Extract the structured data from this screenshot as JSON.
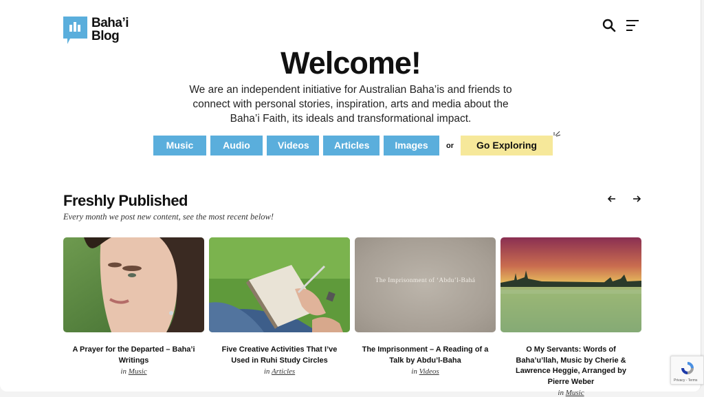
{
  "header": {
    "logo_line1": "Baha’i",
    "logo_line2": "Blog"
  },
  "hero": {
    "title": "Welcome!",
    "intro": "We are an independent initiative for Australian Baha’is and friends to connect with personal stories, inspiration, arts and media about the Baha’i Faith, its ideals and transformational impact.",
    "categories": [
      "Music",
      "Audio",
      "Videos",
      "Articles",
      "Images"
    ],
    "or_label": "or",
    "explore_label": "Go Exploring"
  },
  "fresh": {
    "title": "Freshly Published",
    "subtitle": "Every month we post new content, see the most recent below!"
  },
  "cards": [
    {
      "title": "A Prayer for the Departed – Baha’i Writings",
      "in": "in",
      "category": "Music"
    },
    {
      "title": "Five Creative Activities That I’ve Used in Ruhi Study Circles",
      "in": "in",
      "category": "Articles"
    },
    {
      "title": "The Imprisonment – A Reading of a Talk by Abdu’l-Baha",
      "in": "in",
      "category": "Videos",
      "thumb_caption": "The Imprisonment of ‘Abdu’l-Bahá"
    },
    {
      "title": "O My Servants: Words of Baha’u’llah, Music by Cherie & Lawrence Heggie, Arranged by Pierre Weber",
      "in": "in",
      "category": "Music"
    }
  ],
  "recaptcha": {
    "text": "Privacy - Terms"
  },
  "colors": {
    "accent": "#5aaedc",
    "explore": "#f6e89a"
  }
}
